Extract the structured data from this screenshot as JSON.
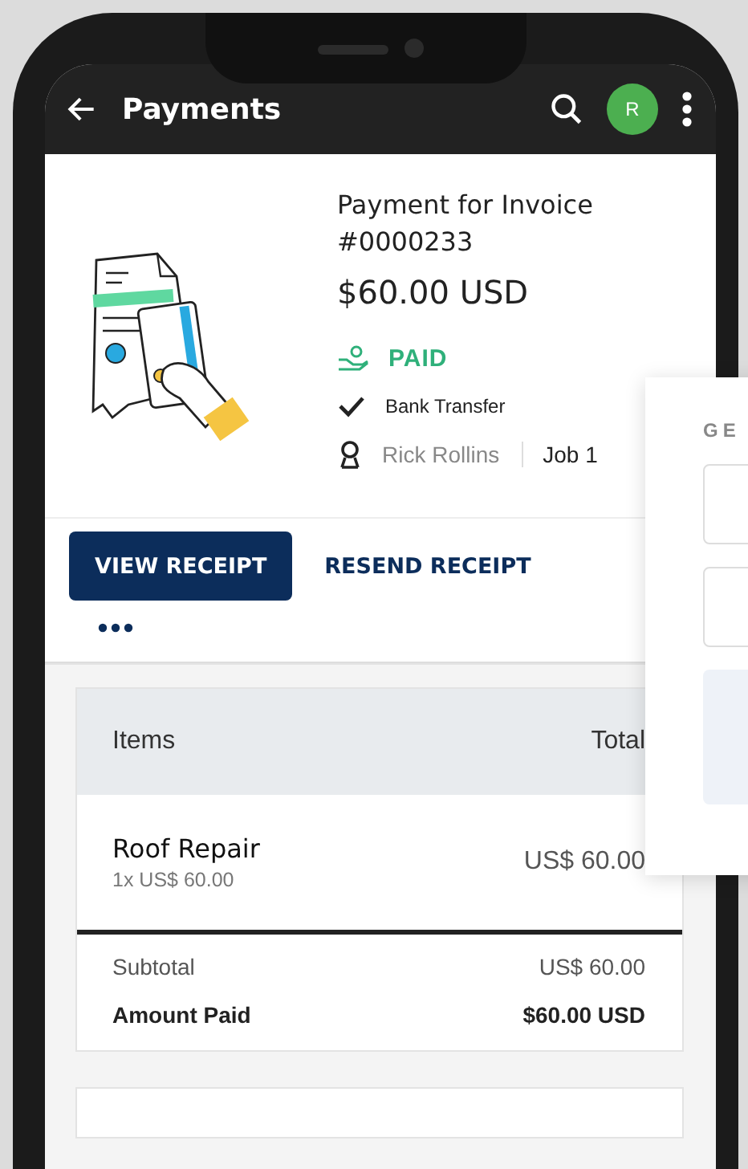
{
  "app_bar": {
    "title": "Payments",
    "avatar": "R"
  },
  "payment": {
    "title": "Payment for Invoice #0000233",
    "amount": "$60.00 USD",
    "status": "PAID",
    "method": "Bank Transfer",
    "client": "Rick Rollins",
    "job": "Job 1"
  },
  "actions": [
    {
      "label": "VIEW RECEIPT",
      "kind": "primary"
    },
    {
      "label": "RESEND RECEIPT",
      "kind": "text"
    }
  ],
  "items_table": {
    "columns": [
      "Items",
      "Total"
    ],
    "rows": [
      {
        "name": "Roof Repair",
        "detail": "1x US$ 60.00",
        "total": "US$ 60.00"
      }
    ],
    "subtotal_label": "Subtotal",
    "subtotal": "US$ 60.00",
    "paid_label": "Amount Paid",
    "paid": "$60.00 USD"
  },
  "overlay_card": {
    "heading": "GE"
  }
}
